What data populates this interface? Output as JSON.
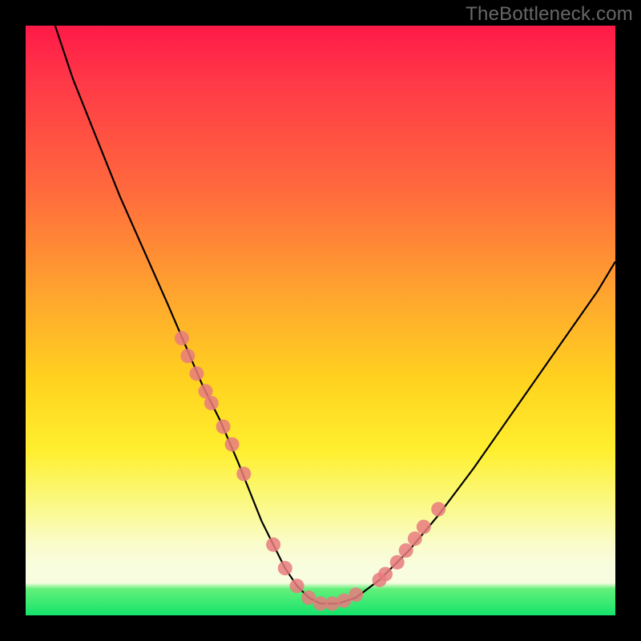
{
  "watermark": "TheBottleneck.com",
  "colors": {
    "frame": "#000000",
    "gradient_top": "#ff1a48",
    "gradient_mid": "#ffd21f",
    "gradient_bottom": "#14e36b",
    "curve": "#000000",
    "marker": "#e77b7e"
  },
  "chart_data": {
    "type": "line",
    "title": "",
    "xlabel": "",
    "ylabel": "",
    "xlim": [
      0,
      100
    ],
    "ylim": [
      0,
      100
    ],
    "grid": false,
    "curve_points": {
      "x": [
        5,
        8,
        12,
        16,
        20,
        24,
        27,
        30,
        33,
        36,
        38,
        40,
        42,
        44,
        46,
        48,
        50,
        53,
        56,
        60,
        65,
        70,
        76,
        83,
        90,
        97,
        100
      ],
      "y": [
        100,
        91,
        81,
        71,
        62,
        53,
        46,
        39,
        33,
        26,
        21,
        16,
        12,
        8,
        5,
        3,
        2,
        2,
        3,
        6,
        11,
        17,
        25,
        35,
        45,
        55,
        60
      ]
    },
    "series": [
      {
        "name": "markers",
        "x": [
          26.5,
          27.5,
          29,
          30.5,
          31.5,
          33.5,
          35,
          37,
          42,
          44,
          46,
          48,
          50,
          52,
          54,
          56,
          60,
          61,
          63,
          64.5,
          66,
          67.5,
          70
        ],
        "y": [
          47,
          44,
          41,
          38,
          36,
          32,
          29,
          24,
          12,
          8,
          5,
          3,
          2,
          2,
          2.5,
          3.5,
          6,
          7,
          9,
          11,
          13,
          15,
          18
        ]
      }
    ]
  }
}
